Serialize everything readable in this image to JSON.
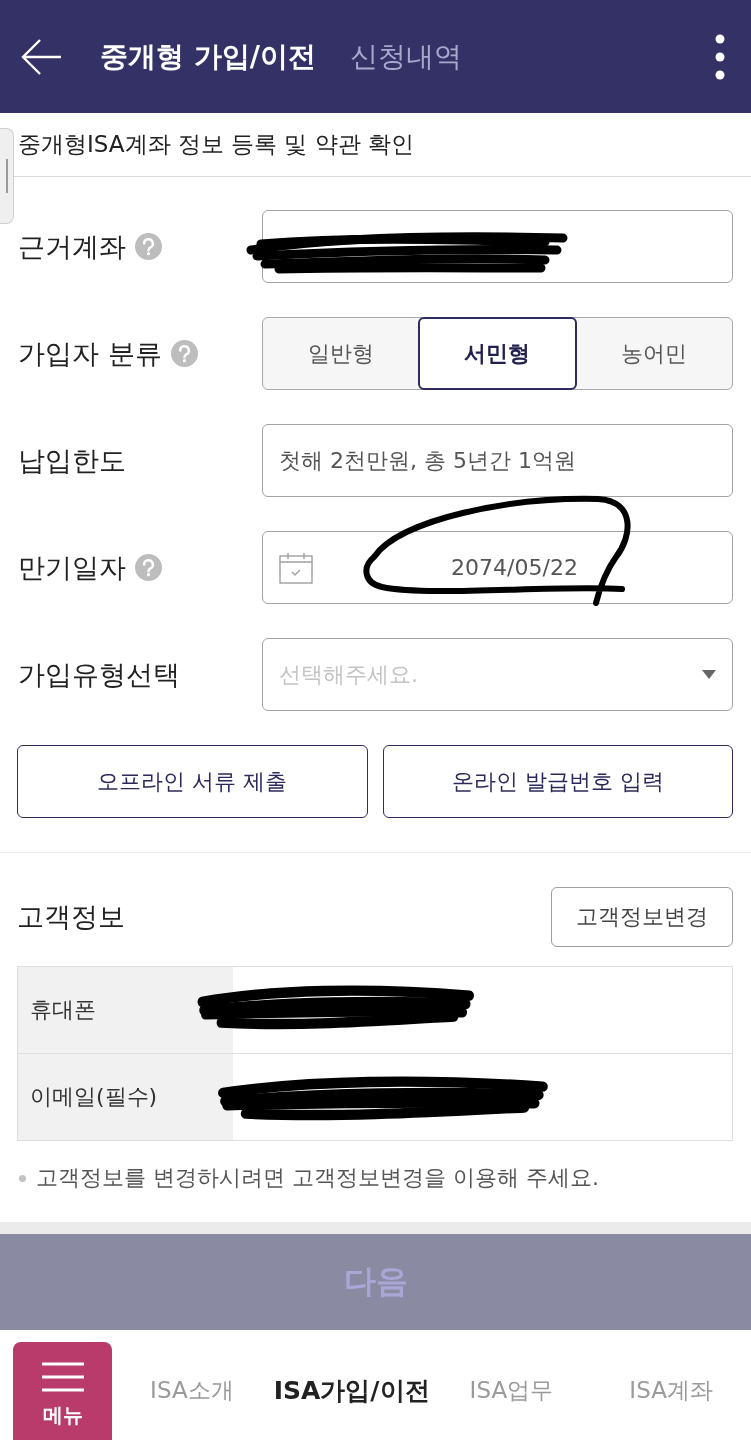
{
  "header": {
    "tabs": [
      {
        "label": "중개형 가입/이전",
        "selected": true
      },
      {
        "label": "신청내역",
        "selected": false
      }
    ]
  },
  "page_title": "중개형ISA계좌 정보 등록 및 약관 확인",
  "form": {
    "rows": [
      {
        "kind": "text",
        "label": "근거계좌",
        "help": true,
        "redacted": true
      },
      {
        "kind": "segmented",
        "label": "가입자 분류",
        "help": true,
        "options": [
          {
            "label": "일반형",
            "selected": false
          },
          {
            "label": "서민형",
            "selected": true
          },
          {
            "label": "농어민",
            "selected": false
          }
        ]
      },
      {
        "kind": "text",
        "label": "납입한도",
        "help": false,
        "value": "첫해 2천만원, 총 5년간 1억원"
      },
      {
        "kind": "date",
        "label": "만기일자",
        "help": true,
        "value": "2074/05/22",
        "circled": true
      },
      {
        "kind": "select",
        "label": "가입유형선택",
        "help": false,
        "placeholder": "선택해주세요."
      }
    ]
  },
  "action_buttons": [
    "오프라인 서류 제출",
    "온라인 발급번호 입력"
  ],
  "customer_info": {
    "title": "고객정보",
    "edit_button": "고객정보변경",
    "rows": [
      {
        "label": "휴대폰",
        "redacted": true
      },
      {
        "label": "이메일(필수)",
        "redacted": true
      }
    ],
    "note": "고객정보를 변경하시려면 고객정보변경을 이용해 주세요."
  },
  "next_button": {
    "label": "다음",
    "disabled": true
  },
  "bottom_nav": {
    "menu_label": "메뉴",
    "items": [
      {
        "label": "ISA소개",
        "selected": false
      },
      {
        "label": "ISA가입/이전",
        "selected": true
      },
      {
        "label": "ISA업무",
        "selected": false
      },
      {
        "label": "ISA계좌",
        "selected": false
      }
    ]
  }
}
